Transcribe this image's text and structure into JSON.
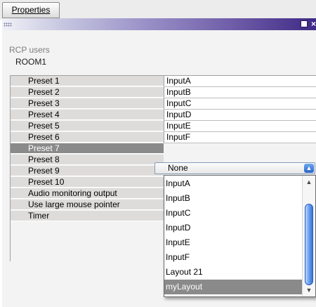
{
  "tabs": {
    "active_label": "Properties"
  },
  "window": {
    "maximize_icon": "maximize-icon",
    "close_icon": "close-icon",
    "close_glyph": "×"
  },
  "panel": {
    "section_label": "RCP users",
    "room_name": "ROOM1"
  },
  "properties": [
    {
      "name": "Preset 1",
      "value": "InputA"
    },
    {
      "name": "Preset 2",
      "value": "InputB"
    },
    {
      "name": "Preset 3",
      "value": "InputC"
    },
    {
      "name": "Preset 4",
      "value": "InputD"
    },
    {
      "name": "Preset 5",
      "value": "InputE"
    },
    {
      "name": "Preset 6",
      "value": "InputF"
    },
    {
      "name": "Preset 7",
      "value": "None"
    },
    {
      "name": "Preset 8",
      "value": ""
    },
    {
      "name": "Preset 9",
      "value": ""
    },
    {
      "name": "Preset 10",
      "value": ""
    },
    {
      "name": "Audio monitoring output",
      "value": ""
    },
    {
      "name": "Use large mouse pointer",
      "value": ""
    },
    {
      "name": "Timer",
      "value": ""
    }
  ],
  "dropdown": {
    "selected": "None",
    "arrow_icon": "updown-arrow-icon",
    "options": [
      "InputA",
      "InputB",
      "InputC",
      "InputD",
      "InputE",
      "InputF",
      "Layout 21",
      "myLayout"
    ],
    "highlighted": "myLayout"
  },
  "colors": {
    "selection": "#8a8a8a",
    "title_gradient_end": "#3f2a85",
    "scroll_thumb": "#5f97ea"
  }
}
